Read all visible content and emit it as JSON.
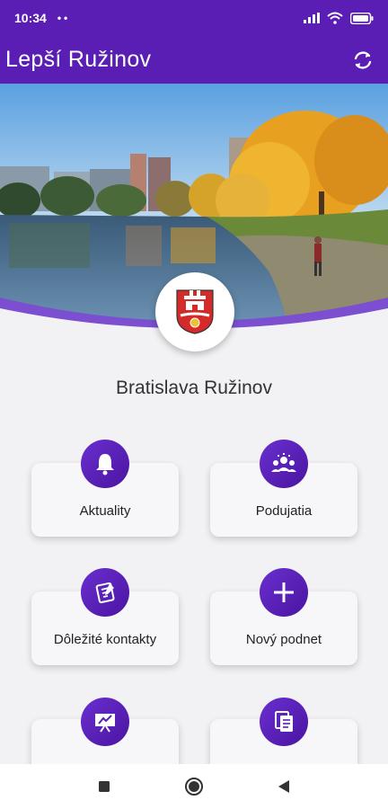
{
  "status": {
    "time": "10:34",
    "dots": "••"
  },
  "appbar": {
    "title": "Lepší Ružinov",
    "refresh_icon": "refresh-icon"
  },
  "city": {
    "name": "Bratislava Ružinov"
  },
  "menu": [
    {
      "label": "Aktuality",
      "icon": "bell-icon"
    },
    {
      "label": "Podujatia",
      "icon": "people-icon"
    },
    {
      "label": "Dôležité kontakty",
      "icon": "notes-icon"
    },
    {
      "label": "Nový podnet",
      "icon": "plus-icon"
    },
    {
      "label": "",
      "icon": "presentation-icon"
    },
    {
      "label": "",
      "icon": "documents-icon"
    }
  ],
  "colors": {
    "primary": "#5a1eb5",
    "background": "#f2f2f5",
    "card": "#f7f7f9"
  },
  "navbar": {
    "buttons": [
      "recents-icon",
      "home-icon",
      "back-icon"
    ]
  }
}
